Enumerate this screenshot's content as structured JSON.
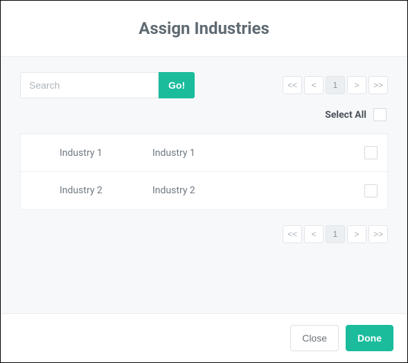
{
  "header": {
    "title": "Assign Industries"
  },
  "search": {
    "placeholder": "Search",
    "button": "Go!"
  },
  "pager": {
    "first": "<<",
    "prev": "<",
    "current": "1",
    "next": ">",
    "last": ">>"
  },
  "select_all": {
    "label": "Select All"
  },
  "rows": [
    {
      "col1": "Industry 1",
      "col2": "Industry 1"
    },
    {
      "col1": "Industry 2",
      "col2": "Industry 2"
    }
  ],
  "footer": {
    "close": "Close",
    "done": "Done"
  }
}
